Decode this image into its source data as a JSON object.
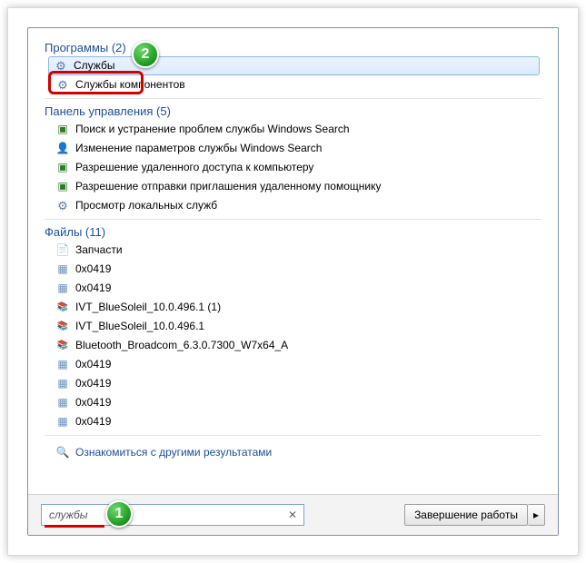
{
  "categories": {
    "programs": {
      "title": "Программы (2)",
      "items": [
        {
          "label": "Службы",
          "icon": "gear-icon",
          "selected": true
        },
        {
          "label": "Службы компонентов",
          "icon": "gear-icon"
        }
      ]
    },
    "control_panel": {
      "title": "Панель управления (5)",
      "items": [
        {
          "label": "Поиск и устранение проблем службы Windows Search",
          "icon": "control-panel-icon"
        },
        {
          "label": "Изменение параметров службы Windows Search",
          "icon": "user-icon"
        },
        {
          "label": "Разрешение удаленного доступа к компьютеру",
          "icon": "control-panel-icon"
        },
        {
          "label": "Разрешение отправки приглашения удаленному помощнику",
          "icon": "control-panel-icon"
        },
        {
          "label": "Просмотр локальных служб",
          "icon": "gear-icon"
        }
      ]
    },
    "files": {
      "title": "Файлы (11)",
      "items": [
        {
          "label": "Запчасти",
          "icon": "word-icon"
        },
        {
          "label": "0x0419",
          "icon": "reg-icon"
        },
        {
          "label": "0x0419",
          "icon": "reg-icon"
        },
        {
          "label": "IVT_BlueSoleil_10.0.496.1 (1)",
          "icon": "archive-icon"
        },
        {
          "label": "IVT_BlueSoleil_10.0.496.1",
          "icon": "archive-icon"
        },
        {
          "label": "Bluetooth_Broadcom_6.3.0.7300_W7x64_A",
          "icon": "archive-icon"
        },
        {
          "label": "0x0419",
          "icon": "reg-icon"
        },
        {
          "label": "0x0419",
          "icon": "reg-icon"
        },
        {
          "label": "0x0419",
          "icon": "reg-icon"
        },
        {
          "label": "0x0419",
          "icon": "reg-icon"
        }
      ]
    }
  },
  "more_results_label": "Ознакомиться с другими результатами",
  "search": {
    "value": "службы"
  },
  "shutdown_label": "Завершение работы",
  "annotations": {
    "badge1": "1",
    "badge2": "2"
  }
}
